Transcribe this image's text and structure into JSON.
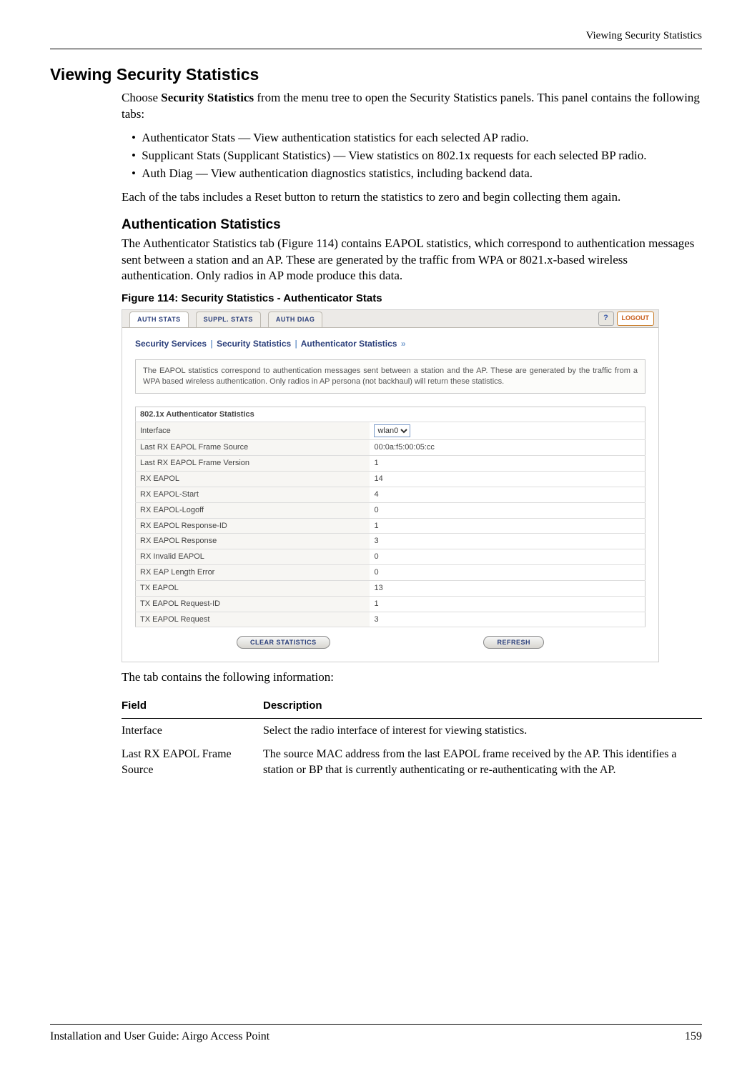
{
  "header": {
    "right_label": "Viewing Security Statistics"
  },
  "heading": "Viewing Security Statistics",
  "intro": {
    "choose_prefix": "Choose ",
    "choose_bold": "Security Statistics",
    "choose_suffix": " from the menu tree to open the Security Statistics panels. This panel contains the following tabs:",
    "bullets": [
      "Authenticator Stats — View authentication statistics for each selected AP radio.",
      "Supplicant Stats (Supplicant Statistics) — View statistics on 802.1x requests for each selected BP radio.",
      "Auth Diag — View authentication diagnostics statistics, including backend data."
    ],
    "reset_text": "Each of the tabs includes a Reset button to return the statistics to zero and begin collecting them again."
  },
  "subheading": "Authentication Statistics",
  "sub_paragraph": "The Authenticator Statistics tab (Figure 114) contains EAPOL statistics, which correspond to authentication messages sent between a station and an AP. These are generated by the traffic from WPA or 8021.x-based wireless authentication. Only radios in AP mode produce this data.",
  "figure_caption": "Figure 114:    Security Statistics - Authenticator Stats",
  "screenshot": {
    "tabs": {
      "auth_stats": "AUTH STATS",
      "suppl_stats": "SUPPL. STATS",
      "auth_diag": "AUTH DIAG"
    },
    "help_label": "?",
    "logout_label": "LOGOUT",
    "breadcrumb": {
      "part1": "Security Services",
      "part2": "Security Statistics",
      "part3": "Authenticator Statistics",
      "sep": "|",
      "arrow": "»"
    },
    "desc_box": "The EAPOL statistics correspond to authentication messages sent between a station and the AP. These are generated by the traffic from a WPA based wireless authentication. Only radios in AP persona (not backhaul) will return these statistics.",
    "table_title": "802.1x Authenticator Statistics",
    "interface_label": "Interface",
    "interface_value": "wlan0",
    "rows": [
      {
        "label": "Last RX EAPOL Frame Source",
        "value": "00:0a:f5:00:05:cc"
      },
      {
        "label": "Last RX EAPOL Frame Version",
        "value": "1"
      },
      {
        "label": "RX EAPOL",
        "value": "14"
      },
      {
        "label": "RX EAPOL-Start",
        "value": "4"
      },
      {
        "label": "RX EAPOL-Logoff",
        "value": "0"
      },
      {
        "label": "RX EAPOL Response-ID",
        "value": "1"
      },
      {
        "label": "RX EAPOL Response",
        "value": "3"
      },
      {
        "label": "RX Invalid EAPOL",
        "value": "0"
      },
      {
        "label": "RX EAP Length Error",
        "value": "0"
      },
      {
        "label": "TX EAPOL",
        "value": "13"
      },
      {
        "label": "TX EAPOL Request-ID",
        "value": "1"
      },
      {
        "label": "TX EAPOL Request",
        "value": "3"
      }
    ],
    "clear_button": "CLEAR STATISTICS",
    "refresh_button": "REFRESH"
  },
  "after_screenshot_text": "The tab contains the following information:",
  "field_table": {
    "head_field": "Field",
    "head_desc": "Description",
    "rows": [
      {
        "field": "Interface",
        "desc": "Select the radio interface of interest for viewing statistics."
      },
      {
        "field": "Last RX EAPOL Frame Source",
        "desc": "The source MAC address from the last EAPOL frame received by the AP. This identifies a station or BP that is currently authenticating or re-authenticating with the AP."
      }
    ]
  },
  "footer": {
    "left": "Installation and User Guide: Airgo Access Point",
    "right": "159"
  }
}
